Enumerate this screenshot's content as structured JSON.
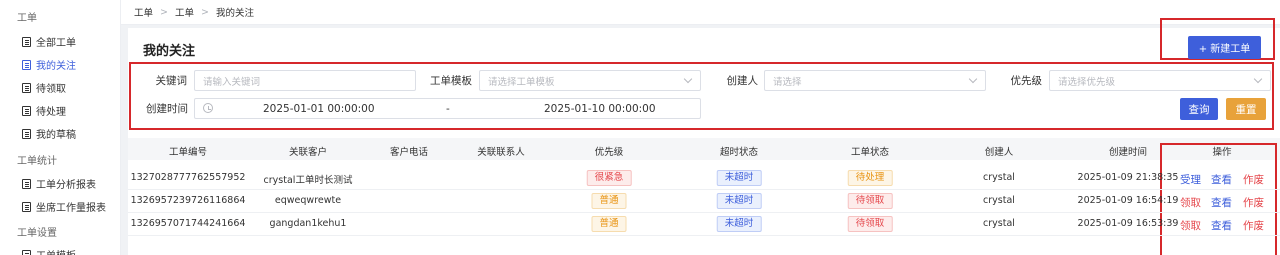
{
  "sidebar": {
    "group1": "工单",
    "items1": [
      {
        "label": "全部工单",
        "active": false
      },
      {
        "label": "我的关注",
        "active": true
      },
      {
        "label": "待领取",
        "active": false
      },
      {
        "label": "待处理",
        "active": false
      },
      {
        "label": "我的草稿",
        "active": false
      }
    ],
    "group2": "工单统计",
    "items2": [
      {
        "label": "工单分析报表"
      },
      {
        "label": "坐席工作量报表"
      }
    ],
    "group3": "工单设置",
    "items3": [
      {
        "label": "工单模板"
      }
    ]
  },
  "breadcrumb": [
    "工单",
    "工单",
    "我的关注"
  ],
  "page_title": "我的关注",
  "new_button": "+ 新建工单",
  "filters": {
    "keyword_label": "关键词",
    "keyword_placeholder": "请输入关键词",
    "template_label": "工单模板",
    "template_placeholder": "请选择工单模板",
    "creator_label": "创建人",
    "creator_placeholder": "请选择",
    "priority_label": "优先级",
    "priority_placeholder": "请选择优先级",
    "created_label": "创建时间",
    "date_start": "2025-01-01 00:00:00",
    "date_sep": "-",
    "date_end": "2025-01-10 00:00:00",
    "query_button": "查询",
    "reset_button": "重置"
  },
  "table": {
    "headers": [
      "工单编号",
      "关联客户",
      "客户电话",
      "关联联系人",
      "优先级",
      "超时状态",
      "工单状态",
      "创建人",
      "创建时间",
      "操作"
    ],
    "rows": [
      {
        "id": "1327028777762557952",
        "customer": "crystal工单时长测试",
        "phone": "",
        "contact": "",
        "priority": "很紧急",
        "timeout": "未超时",
        "status": "待处理",
        "creator": "crystal",
        "created": "2025-01-09 21:38:35",
        "actions": [
          "受理",
          "查看",
          "作废"
        ]
      },
      {
        "id": "1326957239726116864",
        "customer": "eqweqwrewte",
        "phone": "",
        "contact": "",
        "priority": "普通",
        "timeout": "未超时",
        "status": "待领取",
        "creator": "crystal",
        "created": "2025-01-09 16:54:19",
        "actions": [
          "领取",
          "查看",
          "作废"
        ]
      },
      {
        "id": "1326957071744241664",
        "customer": "gangdan1kehu1",
        "phone": "",
        "contact": "",
        "priority": "普通",
        "timeout": "未超时",
        "status": "待领取",
        "creator": "crystal",
        "created": "2025-01-09 16:53:39",
        "actions": [
          "领取",
          "查看",
          "作废"
        ]
      }
    ]
  },
  "icons": {
    "sidebar_item": "document-icon",
    "clock": "clock-icon",
    "select": "chevron-down-icon"
  },
  "colors": {
    "primary": "#3e5fdb",
    "warning": "#e8920f",
    "danger": "#e5484d",
    "highlight_box": "#d6282b"
  }
}
